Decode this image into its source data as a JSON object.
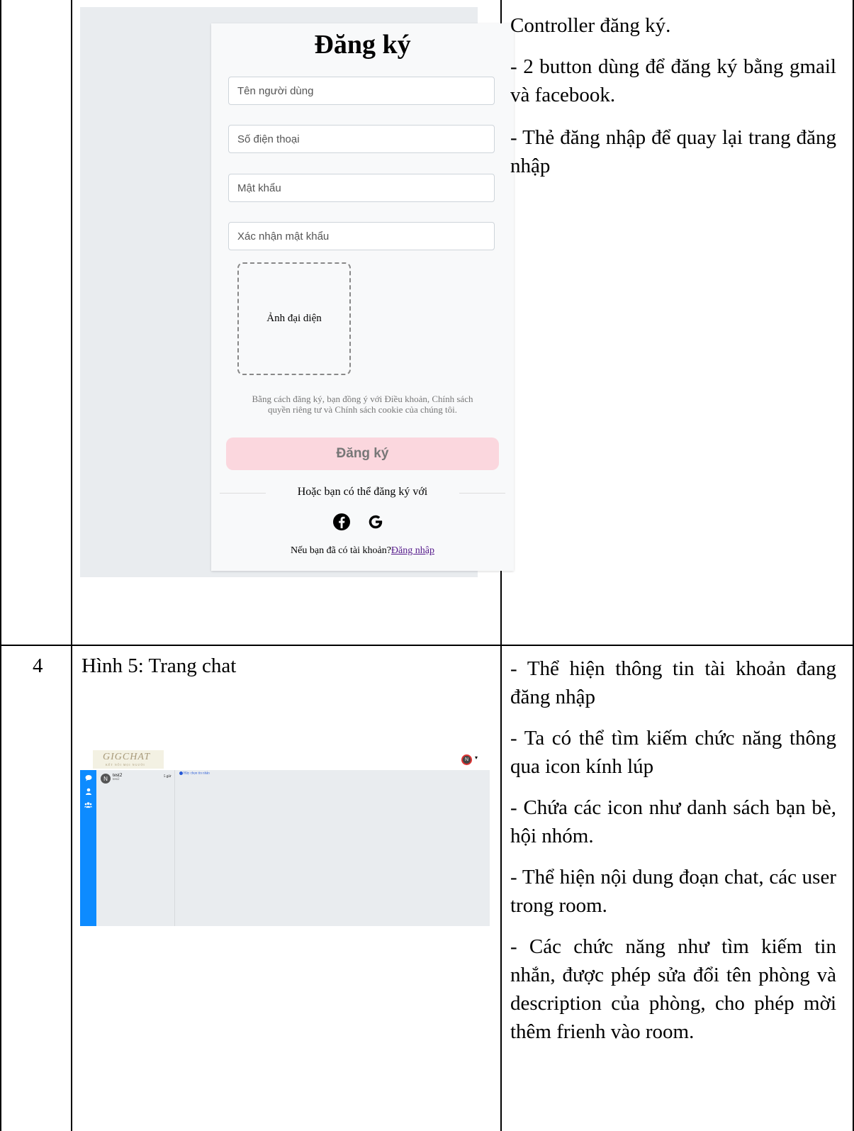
{
  "row3": {
    "register": {
      "title": "Đăng ký",
      "fields": [
        "Tên người dùng",
        "Số điện thoại",
        "Mật khẩu",
        "Xác nhận mật khẩu"
      ],
      "avatar_label": "Ảnh đại diện",
      "terms_line1": "Bằng cách đăng ký, bạn đồng ý với Điều khoản, Chính sách",
      "terms_line2": "quyền riêng tư và Chính sách cookie của chúng tôi.",
      "submit_label": "Đăng ký",
      "alt_text": "Hoặc bạn có thể đăng ký với",
      "social_icons": [
        "facebook-icon",
        "google-icon"
      ],
      "have_account_text": "Nếu bạn đã có tài khoản?",
      "login_link": "Đăng nhập"
    },
    "description": [
      "Controller đăng ký.",
      "- 2 button dùng để đăng ký bằng gmail và facebook.",
      "- Thẻ đăng nhập để quay lại trang đăng nhập"
    ]
  },
  "row4": {
    "number": "4",
    "caption": "Hình 5: Trang chat",
    "chat": {
      "logo": "GIGCHAT",
      "logo_sub": "KẾT NỐI MỌI NGƯỜI",
      "user_initial": "N",
      "contact_name": "test2",
      "contact_sub": "test2",
      "contact_initial": "N",
      "contact_time": "5 giờ",
      "hint": "Hãy chọn tin nhắn",
      "accent": "#0d8bff"
    },
    "description": [
      "- Thể hiện thông tin tài khoản đang đăng nhập",
      "- Ta có thể tìm kiếm chức năng thông qua icon kính lúp",
      "- Chứa các icon như danh sách bạn bè, hội nhóm.",
      "- Thể hiện nội dung đoạn chat, các user trong room.",
      "- Các chức năng như tìm kiếm tin nhắn, được phép sửa đổi tên phòng và description của phòng, cho phép mời thêm frienh vào room."
    ]
  }
}
